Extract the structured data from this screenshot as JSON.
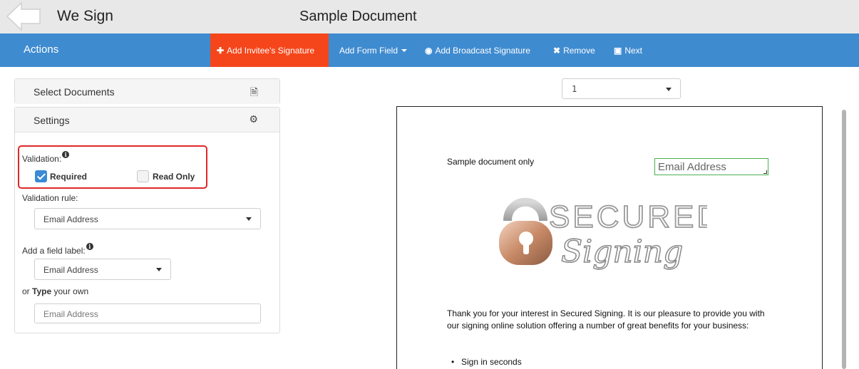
{
  "header": {
    "app_title": "We Sign",
    "document_title": "Sample Document"
  },
  "actionbar": {
    "label": "Actions",
    "add_invitee": "Add Invitee's Signature",
    "add_form_field": "Add Form Field",
    "add_broadcast": "Add Broadcast Signature",
    "remove": "Remove",
    "next": "Next",
    "accent_color": "#f5461b",
    "bar_color": "#3f8bd0"
  },
  "sidebar": {
    "select_documents": "Select Documents",
    "settings": "Settings",
    "validation_label": "Validation:",
    "required_label": "Required",
    "required_checked": true,
    "readonly_label": "Read Only",
    "readonly_checked": false,
    "validation_rule_label": "Validation rule:",
    "validation_rule_value": "Email Address",
    "field_label_label": "Add a field label:",
    "field_label_value": "Email Address",
    "own_prefix": "or ",
    "own_bold": "Type",
    "own_suffix": " your own",
    "own_placeholder": "Email Address"
  },
  "viewer": {
    "page_number": "1",
    "doc_heading": "Sample document only",
    "email_field": "Email Address",
    "logo_line1": "SECURED",
    "logo_line2": "Signing",
    "paragraph": "Thank you for your interest in Secured Signing. It is our pleasure to provide you with our signing online solution offering a number of great benefits for your business:",
    "bullet1": "Sign in seconds"
  }
}
